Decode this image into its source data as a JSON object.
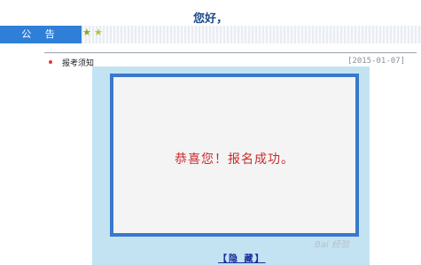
{
  "header": {
    "greeting": "您好，"
  },
  "tabs": {
    "announcement_label": "公 告"
  },
  "icons": {
    "star_a": "★",
    "star_b": "★"
  },
  "notices": [
    {
      "title": "报考须知",
      "date": "[2015-01-07]"
    }
  ],
  "popup": {
    "message": "恭喜您！报名成功。",
    "hide_link": "【隐 藏】"
  },
  "watermark": {
    "text": "Bai 经验"
  },
  "colors": {
    "tab_blue": "#2f7fd8",
    "popup_frame": "#c3e3f3",
    "inner_border": "#3a78cc",
    "message_red": "#cc2a2a",
    "link_blue": "#1a2f9a"
  }
}
